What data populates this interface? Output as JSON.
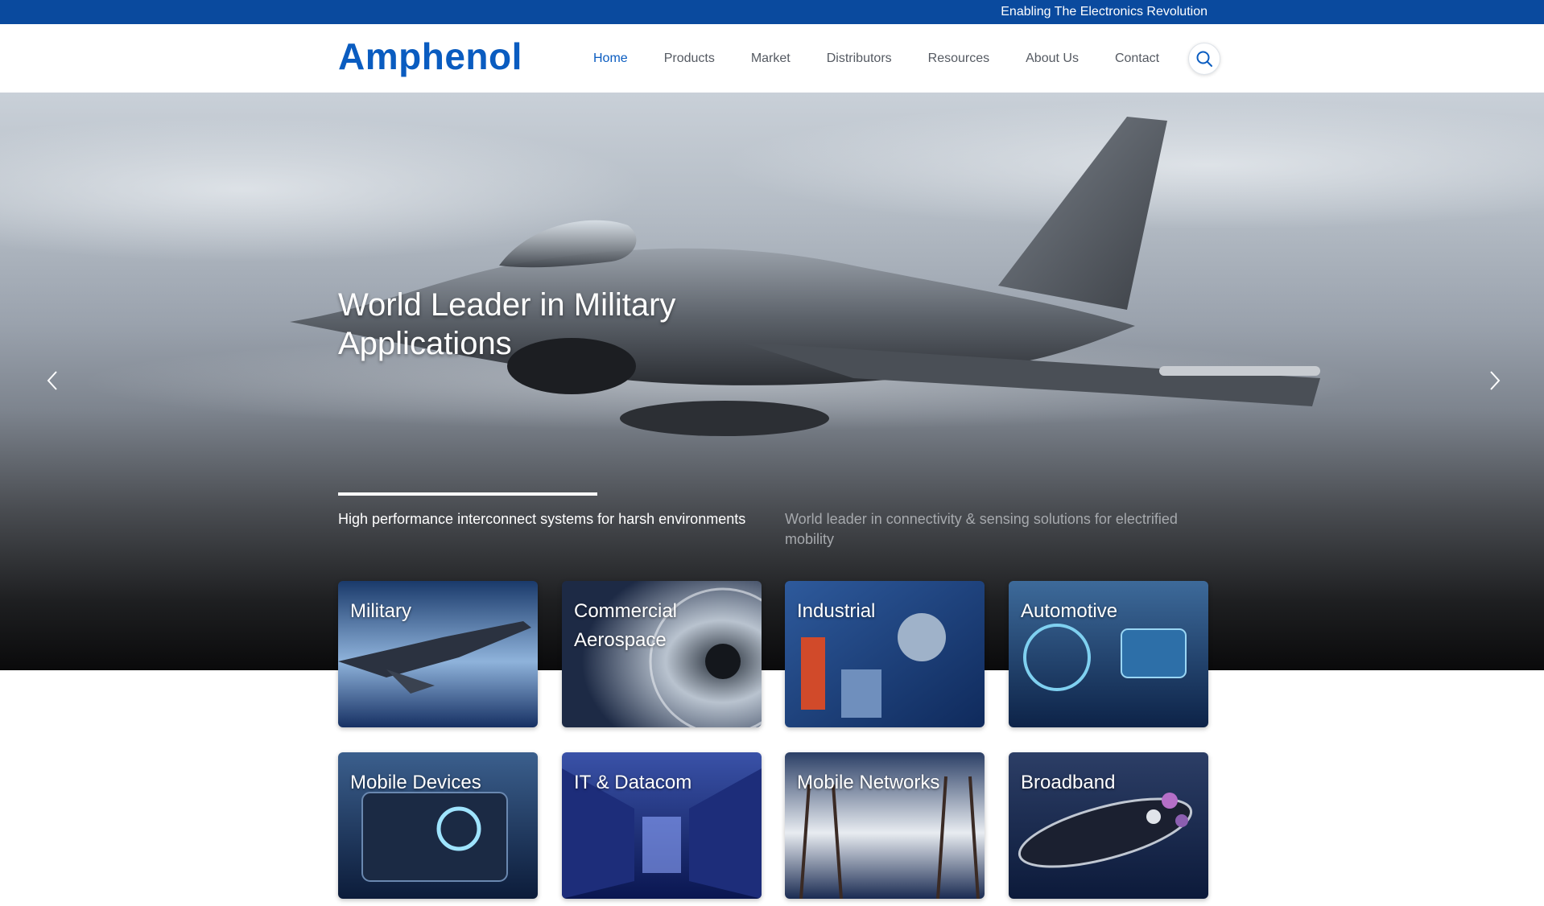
{
  "topbar": {
    "tagline": "Enabling The Electronics Revolution"
  },
  "header": {
    "logo": "Amphenol",
    "nav": [
      {
        "label": "Home",
        "active": true
      },
      {
        "label": "Products",
        "active": false
      },
      {
        "label": "Market",
        "active": false
      },
      {
        "label": "Distributors",
        "active": false
      },
      {
        "label": "Resources",
        "active": false
      },
      {
        "label": "About Us",
        "active": false
      },
      {
        "label": "Contact",
        "active": false
      }
    ],
    "search_icon": "search-icon"
  },
  "hero": {
    "title": "World Leader in Military Applications",
    "slides": [
      {
        "caption": "High performance interconnect systems for harsh environments",
        "active": true
      },
      {
        "caption": "World leader in connectivity & sensing solutions for electrified mobility",
        "active": false
      }
    ],
    "progress": 1.0,
    "prev_icon": "chevron-left-icon",
    "next_icon": "chevron-right-icon"
  },
  "markets": [
    {
      "label": "Military",
      "image": "fighter-jet"
    },
    {
      "label": "Commercial Aerospace",
      "image": "jet-engine"
    },
    {
      "label": "Industrial",
      "image": "robot-arms"
    },
    {
      "label": "Automotive",
      "image": "car-dashboard"
    },
    {
      "label": "Mobile Devices",
      "image": "tablet"
    },
    {
      "label": "IT & Datacom",
      "image": "server-racks"
    },
    {
      "label": "Mobile Networks",
      "image": "cell-towers"
    },
    {
      "label": "Broadband",
      "image": "fiber-cable"
    }
  ],
  "colors": {
    "brand_blue": "#0a5cc0",
    "topbar_blue": "#0a4a9e",
    "nav_text": "#555a62"
  }
}
